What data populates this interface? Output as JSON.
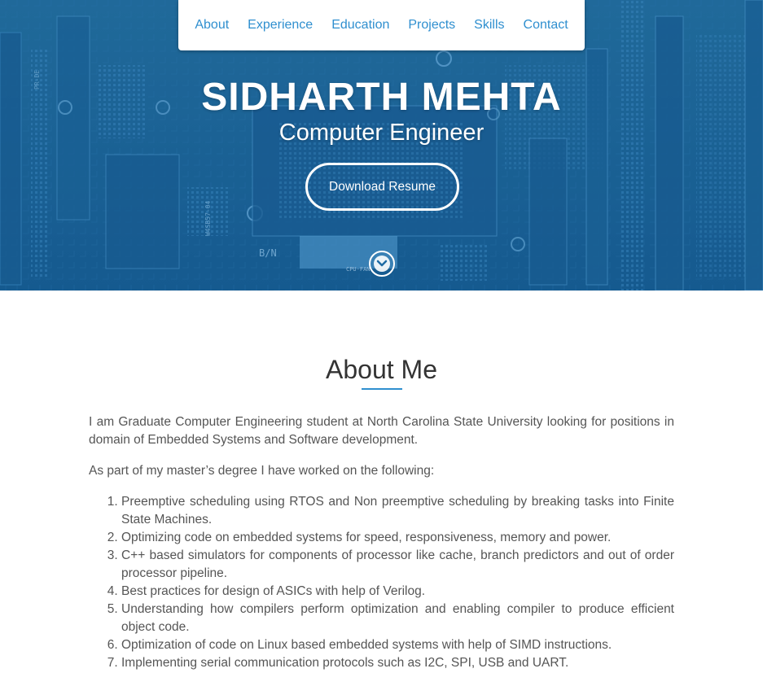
{
  "nav": {
    "items": [
      "About",
      "Experience",
      "Education",
      "Projects",
      "Skills",
      "Contact"
    ]
  },
  "hero": {
    "name": "SIDHARTH MEHTA",
    "title": "Computer Engineer",
    "resume_label": "Download Resume",
    "board_labels": [
      "B/N",
      "CPU-FAN",
      "W4SB57-04",
      "PR-DE"
    ],
    "colors": {
      "background": "#1f6aa3",
      "accent": "#ffffff"
    }
  },
  "about": {
    "heading": "About Me",
    "intro": "I am Graduate Computer Engineering student at North Carolina State University looking for positions in domain of Embedded Systems and Software development.",
    "lead": "As part of my master’s degree I have worked on the following:",
    "items": [
      "Preemptive scheduling using RTOS and Non preemptive scheduling by breaking tasks into Finite State Machines.",
      "Optimizing code on embedded systems for speed, responsiveness, memory and power.",
      "C++ based simulators for components of processor like cache, branch predictors and out of order processor pipeline.",
      "Best practices for design of ASICs with help of Verilog.",
      "Understanding how compilers perform optimization and enabling compiler to produce efficient object code.",
      "Optimization of code on Linux based embedded systems with help of SIMD instructions.",
      "Implementing serial communication protocols such as I2C, SPI, USB and UART."
    ]
  },
  "icons": {
    "scroll": "chevron-down-circle-icon"
  },
  "colors": {
    "link": "#2f8fcf",
    "text": "#555555"
  }
}
